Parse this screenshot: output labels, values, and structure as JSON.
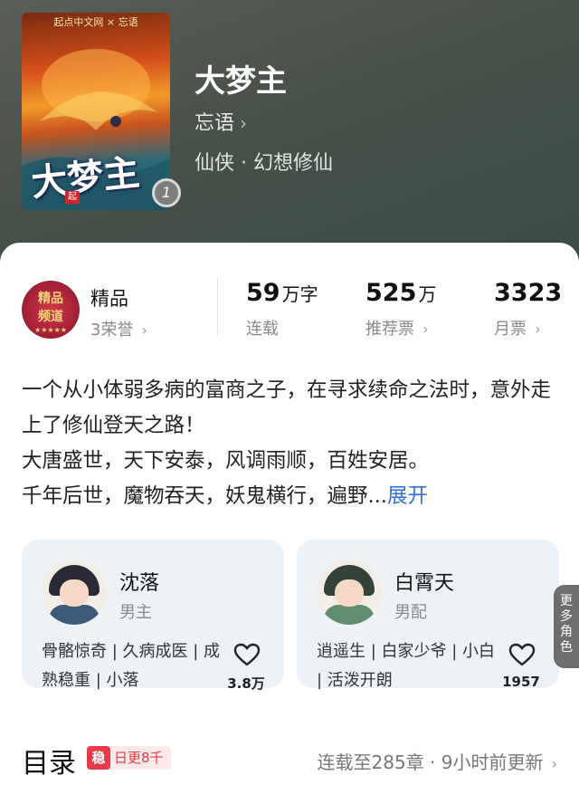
{
  "book": {
    "cover_top_text": "起点中文网 × 忘语",
    "cover_title": "大梦主",
    "cover_badge": "起",
    "volume_badge": "1",
    "title": "大梦主",
    "author": "忘语",
    "genre": "仙侠 · 幻想修仙"
  },
  "stats": {
    "level": {
      "emblem_text": "精品\n频道",
      "emblem_sub": "★★★★★",
      "label": "精品",
      "honor": "3荣誉"
    },
    "words": {
      "number": "59",
      "unit": "万字",
      "label": "连载"
    },
    "recommend": {
      "number": "525",
      "unit": "万",
      "label": "推荐票"
    },
    "monthly": {
      "number": "3323",
      "label": "月票"
    }
  },
  "description": {
    "lines": [
      "一个从小体弱多病的富商之子，在寻求续命之法时，意外走上了修仙登天之路！",
      "大唐盛世，天下安泰，风调雨顺，百姓安居。",
      "千年后世，魔物吞天，妖鬼横行，遍野..."
    ],
    "expand": "展开"
  },
  "characters": [
    {
      "name": "沈落",
      "role": "男主",
      "tags": "骨骼惊奇 | 久病成医 | 成熟稳重 | 小落",
      "likes": "3.8万"
    },
    {
      "name": "白霄天",
      "role": "男配",
      "tags": "逍遥生 | 白家少爷 | 小白 | 活泼开朗",
      "likes": "1957"
    }
  ],
  "more_roles": "更多角色",
  "toc": {
    "title": "目录",
    "badge_icon": "稳",
    "badge_text": "日更8千",
    "status": "连载至285章 · 9小时前更新"
  },
  "colors": {
    "accent_blue": "#2f6fe0",
    "badge_red": "#e83a48",
    "card_bg": "#edf2f7"
  },
  "icons": [
    "chevron-right-icon",
    "heart-icon"
  ]
}
